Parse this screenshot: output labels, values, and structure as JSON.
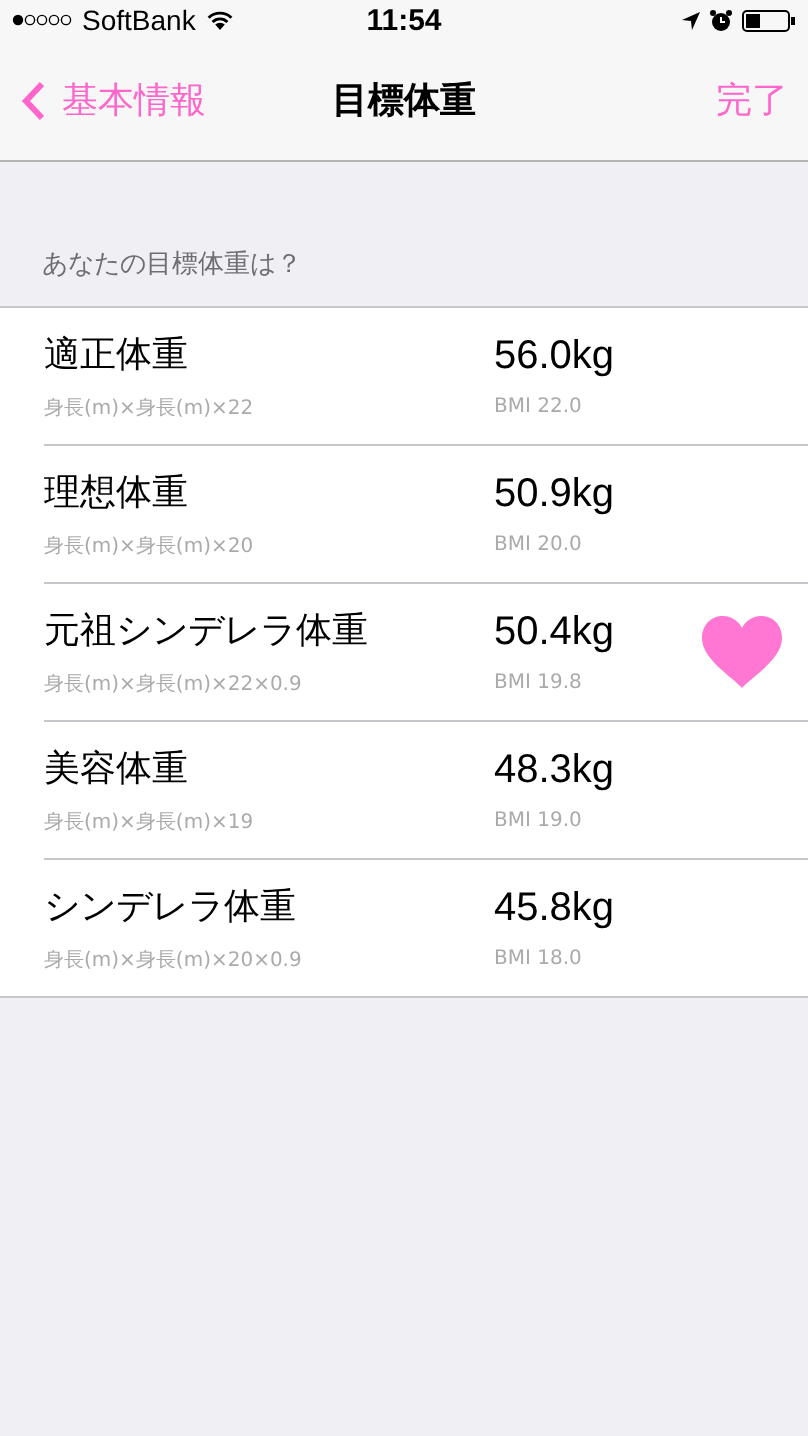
{
  "status_bar": {
    "carrier": "SoftBank",
    "time": "11:54"
  },
  "nav": {
    "back": "基本情報",
    "title": "目標体重",
    "done": "完了"
  },
  "section_header": "あなたの目標体重は？",
  "rows": [
    {
      "name": "適正体重",
      "formula": "身長(m)×身長(m)×22",
      "weight": "56.0kg",
      "bmi": "BMI 22.0",
      "selected": false
    },
    {
      "name": "理想体重",
      "formula": "身長(m)×身長(m)×20",
      "weight": "50.9kg",
      "bmi": "BMI 20.0",
      "selected": false
    },
    {
      "name": "元祖シンデレラ体重",
      "formula": "身長(m)×身長(m)×22×0.9",
      "weight": "50.4kg",
      "bmi": "BMI 19.8",
      "selected": true
    },
    {
      "name": "美容体重",
      "formula": "身長(m)×身長(m)×19",
      "weight": "48.3kg",
      "bmi": "BMI 19.0",
      "selected": false
    },
    {
      "name": "シンデレラ体重",
      "formula": "身長(m)×身長(m)×20×0.9",
      "weight": "45.8kg",
      "bmi": "BMI 18.0",
      "selected": false
    }
  ]
}
